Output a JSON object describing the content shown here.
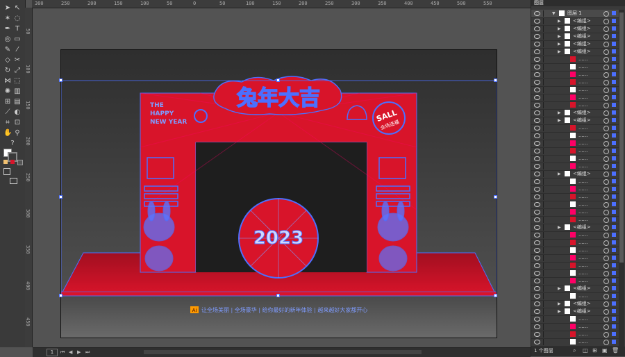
{
  "ruler": {
    "top_labels": [
      "300",
      "250",
      "200",
      "150",
      "100",
      "50",
      "0",
      "50",
      "100",
      "150",
      "200",
      "250",
      "300",
      "350",
      "400",
      "450",
      "500",
      "550"
    ],
    "left_labels": [
      "50",
      "100",
      "150",
      "200",
      "250",
      "300",
      "350",
      "400",
      "450"
    ]
  },
  "artwork": {
    "title_text": "兔年大吉",
    "badge_text": "SALL",
    "badge_sub": "全场送福",
    "happy_lines": [
      "THE",
      "HAPPY",
      "NEW YEAR"
    ],
    "center_number": "2023",
    "bottom_caption": "让全场美丽 | 全场豪华 | 给你最好的新年体验 | 越来越好大家都开心",
    "ai_badge": "Ai"
  },
  "layers_panel": {
    "title": "图层",
    "top_layer": "图层 1",
    "group_label": "<编组>",
    "path_label": "......",
    "footer_count": "1 个图层",
    "rows": [
      {
        "kind": "layer",
        "label": "图层 1"
      },
      {
        "kind": "group",
        "label": "<编组>"
      },
      {
        "kind": "group",
        "label": "<编组>"
      },
      {
        "kind": "group",
        "label": "<编组>"
      },
      {
        "kind": "group",
        "label": "<编组>"
      },
      {
        "kind": "group",
        "label": "<编组>"
      },
      {
        "kind": "path",
        "label": "......"
      },
      {
        "kind": "path",
        "label": "......"
      },
      {
        "kind": "path",
        "label": "......"
      },
      {
        "kind": "path",
        "label": "......"
      },
      {
        "kind": "path",
        "label": "......"
      },
      {
        "kind": "path",
        "label": "......"
      },
      {
        "kind": "path",
        "label": "......"
      },
      {
        "kind": "group",
        "label": "<编组>"
      },
      {
        "kind": "group",
        "label": "<编组>"
      },
      {
        "kind": "path",
        "label": "......"
      },
      {
        "kind": "path",
        "label": "......"
      },
      {
        "kind": "path",
        "label": "......"
      },
      {
        "kind": "path",
        "label": "......"
      },
      {
        "kind": "path",
        "label": "......"
      },
      {
        "kind": "path",
        "label": "......"
      },
      {
        "kind": "group",
        "label": "<编组>"
      },
      {
        "kind": "path",
        "label": "......"
      },
      {
        "kind": "path",
        "label": "......"
      },
      {
        "kind": "path",
        "label": "......"
      },
      {
        "kind": "path",
        "label": "......"
      },
      {
        "kind": "path",
        "label": "......"
      },
      {
        "kind": "path",
        "label": "......"
      },
      {
        "kind": "group",
        "label": "<编组>"
      },
      {
        "kind": "path",
        "label": "......"
      },
      {
        "kind": "path",
        "label": "......"
      },
      {
        "kind": "path",
        "label": "......"
      },
      {
        "kind": "path",
        "label": "......"
      },
      {
        "kind": "path",
        "label": "......"
      },
      {
        "kind": "path",
        "label": "......"
      },
      {
        "kind": "path",
        "label": "......"
      },
      {
        "kind": "group",
        "label": "<编组>"
      },
      {
        "kind": "path",
        "label": "......"
      },
      {
        "kind": "group",
        "label": "<编组>"
      },
      {
        "kind": "group",
        "label": "<编组>"
      },
      {
        "kind": "path",
        "label": "......"
      },
      {
        "kind": "path",
        "label": "......"
      },
      {
        "kind": "path",
        "label": "......"
      },
      {
        "kind": "path",
        "label": "......"
      }
    ]
  },
  "status": {
    "zoom": "",
    "page": "1"
  },
  "colors": {
    "accent": "#4c6fff",
    "red": "#d8142a",
    "darkred": "#8a0a18"
  }
}
